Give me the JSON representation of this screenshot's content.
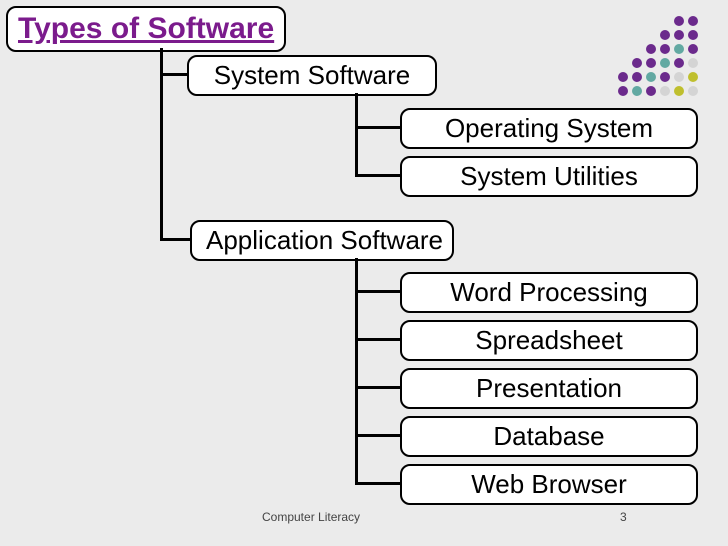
{
  "root": "Types of Software",
  "level1": {
    "system": "System Software",
    "application": "Application Software"
  },
  "system_children": {
    "os": "Operating System",
    "util": "System Utilities"
  },
  "app_children": {
    "word": "Word Processing",
    "sheet": "Spreadsheet",
    "pres": "Presentation",
    "db": "Database",
    "web": "Web Browser"
  },
  "footer": {
    "title": "Computer Literacy",
    "page": "3"
  },
  "dot_colors": [
    [
      null,
      null,
      null,
      null,
      "#6b2a8c",
      "#6b2a8c"
    ],
    [
      null,
      null,
      null,
      "#6b2a8c",
      "#6b2a8c",
      "#6b2a8c"
    ],
    [
      null,
      null,
      "#6b2a8c",
      "#6b2a8c",
      "#62a9a2",
      "#6b2a8c"
    ],
    [
      null,
      "#6b2a8c",
      "#6b2a8c",
      "#62a9a2",
      "#6b2a8c",
      "#d4d4d4"
    ],
    [
      "#6b2a8c",
      "#6b2a8c",
      "#62a9a2",
      "#6b2a8c",
      "#d4d4d4",
      "#bfbf2e"
    ],
    [
      "#6b2a8c",
      "#62a9a2",
      "#6b2a8c",
      "#d4d4d4",
      "#bfbf2e",
      "#d4d4d4"
    ]
  ]
}
